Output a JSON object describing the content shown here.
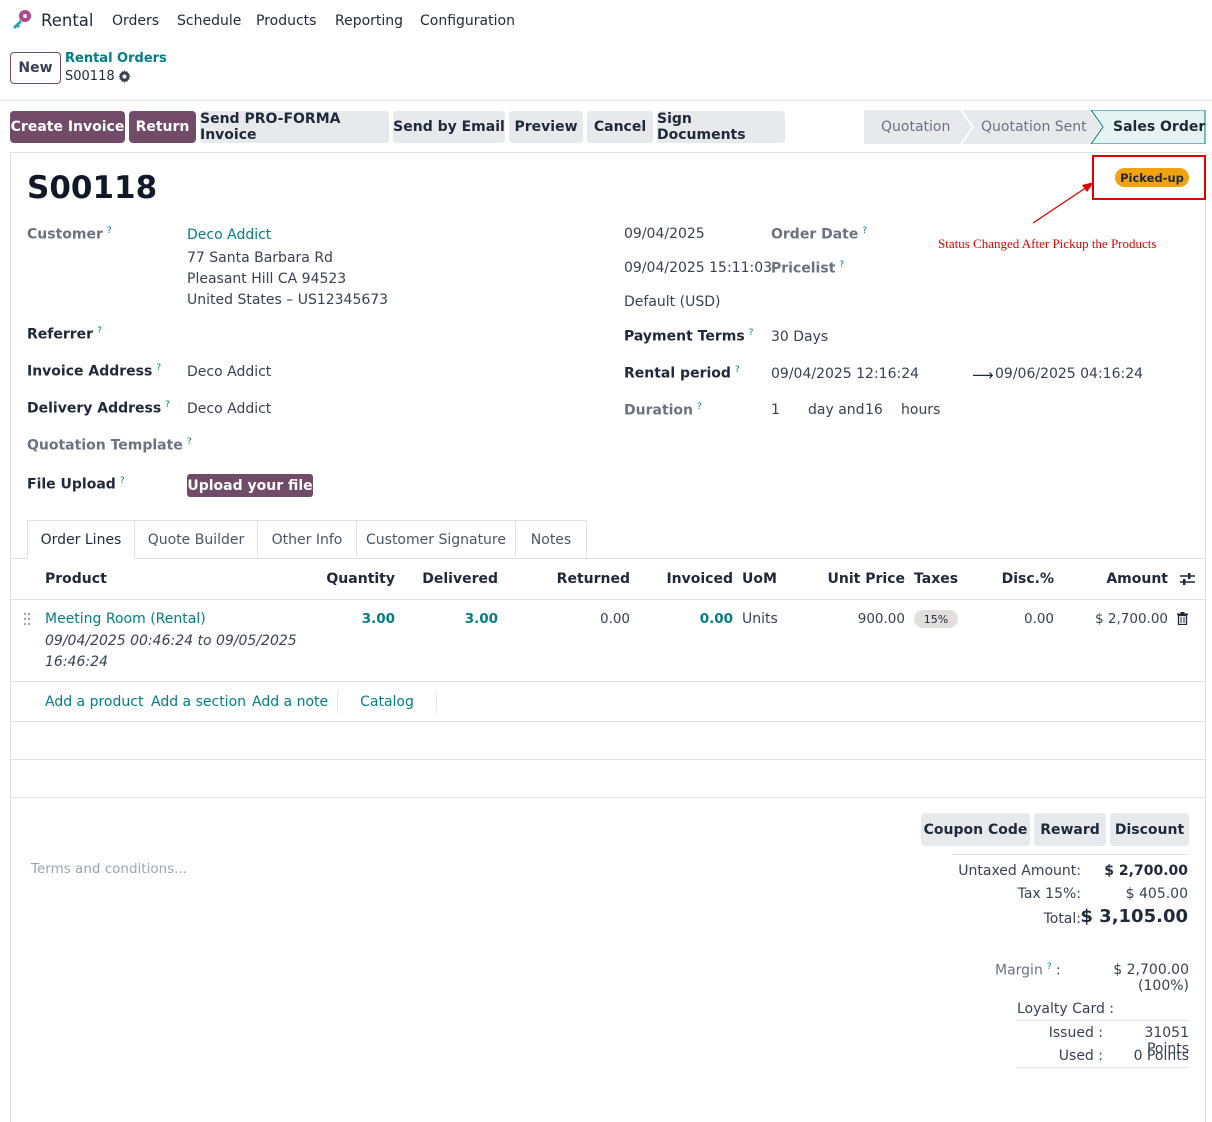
{
  "nav": {
    "app_name": "Rental",
    "menu": [
      "Orders",
      "Schedule",
      "Products",
      "Reporting",
      "Configuration"
    ]
  },
  "control": {
    "new_label": "New",
    "breadcrumb_parent": "Rental Orders",
    "breadcrumb_current": "S00118"
  },
  "actions": {
    "create_invoice": "Create Invoice",
    "return": "Return",
    "send_proforma": "Send PRO-FORMA Invoice",
    "send_email": "Send by Email",
    "preview": "Preview",
    "cancel": "Cancel",
    "sign_documents": "Sign Documents"
  },
  "statusbar": {
    "steps": [
      "Quotation",
      "Quotation Sent",
      "Sales Order"
    ],
    "active": "Sales Order"
  },
  "record": {
    "name": "S00118",
    "badge": "Picked-up",
    "annotation": "Status Changed After Pickup the Products"
  },
  "form": {
    "customer_label": "Customer",
    "customer_name": "Deco Addict",
    "address_line1": "77 Santa Barbara Rd",
    "address_line2": "Pleasant Hill CA 94523",
    "address_line3": "United States – US12345673",
    "referrer_label": "Referrer",
    "invoice_address_label": "Invoice Address",
    "invoice_address_value": "Deco Addict",
    "delivery_address_label": "Delivery Address",
    "delivery_address_value": "Deco Addict",
    "quotation_template_label": "Quotation Template",
    "file_upload_label": "File Upload",
    "upload_button": "Upload your file",
    "expiration": "09/04/2025",
    "order_date_value": "09/04/2025 15:11:03",
    "currency": "Default (USD)",
    "order_date_label": "Order Date",
    "pricelist_label": "Pricelist",
    "payment_terms_label": "Payment Terms",
    "payment_terms_value": "30 Days",
    "rental_period_label": "Rental period",
    "rental_start": "09/04/2025 12:16:24",
    "rental_end": "09/06/2025 04:16:24",
    "duration_label": "Duration",
    "duration_days": "1",
    "duration_day_unit": "day and",
    "duration_hours": "16",
    "duration_hour_unit": "hours"
  },
  "tabs": [
    "Order Lines",
    "Quote Builder",
    "Other Info",
    "Customer Signature",
    "Notes"
  ],
  "table": {
    "headers": {
      "product": "Product",
      "quantity": "Quantity",
      "delivered": "Delivered",
      "returned": "Returned",
      "invoiced": "Invoiced",
      "uom": "UoM",
      "unit_price": "Unit Price",
      "taxes": "Taxes",
      "disc": "Disc.%",
      "amount": "Amount"
    },
    "rows": [
      {
        "product": "Meeting Room (Rental)",
        "period_line1": "09/04/2025 00:46:24 to 09/05/2025",
        "period_line2": "16:46:24",
        "quantity": "3.00",
        "delivered": "3.00",
        "returned": "0.00",
        "invoiced": "0.00",
        "uom": "Units",
        "unit_price": "900.00",
        "tax": "15%",
        "disc": "0.00",
        "amount": "$ 2,700.00"
      }
    ],
    "add_product": "Add a product",
    "add_section": "Add a section",
    "add_note": "Add a note",
    "catalog": "Catalog"
  },
  "footer": {
    "terms_placeholder": "Terms and conditions...",
    "coupon_code": "Coupon Code",
    "reward": "Reward",
    "discount": "Discount",
    "untaxed_label": "Untaxed Amount:",
    "untaxed_value": "$ 2,700.00",
    "tax_label": "Tax 15%:",
    "tax_value": "$ 405.00",
    "total_label": "Total:",
    "total_value": "$ 3,105.00",
    "margin_label": "Margin",
    "margin_value": "$ 2,700.00 (100%)",
    "loyalty_label": "Loyalty Card :",
    "issued_label": "Issued :",
    "issued_value": "31051 Points",
    "used_label": "Used :",
    "used_value": "0 Points"
  },
  "colors": {
    "brand": "#714b67",
    "accent": "#017e84",
    "badge": "#f0a30f",
    "annotation": "#e00000"
  }
}
